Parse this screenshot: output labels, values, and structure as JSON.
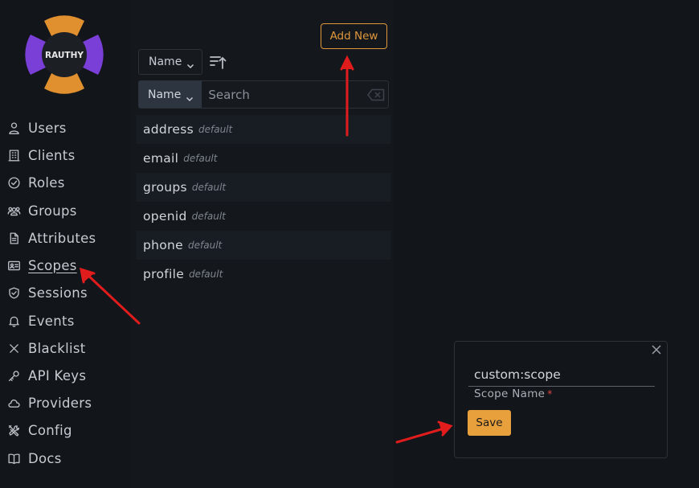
{
  "logo": {
    "text": "RAUTHY"
  },
  "nav": {
    "items": [
      {
        "label": "Users",
        "icon": "user-icon"
      },
      {
        "label": "Clients",
        "icon": "building-icon"
      },
      {
        "label": "Roles",
        "icon": "check-circle-icon"
      },
      {
        "label": "Groups",
        "icon": "users-group-icon"
      },
      {
        "label": "Attributes",
        "icon": "document-icon"
      },
      {
        "label": "Scopes",
        "icon": "id-card-icon",
        "active": true
      },
      {
        "label": "Sessions",
        "icon": "shield-check-icon"
      },
      {
        "label": "Events",
        "icon": "bell-icon"
      },
      {
        "label": "Blacklist",
        "icon": "x-icon"
      },
      {
        "label": "API Keys",
        "icon": "key-icon"
      },
      {
        "label": "Providers",
        "icon": "cloud-icon"
      },
      {
        "label": "Config",
        "icon": "tools-icon"
      },
      {
        "label": "Docs",
        "icon": "book-icon"
      }
    ]
  },
  "toolbar": {
    "add_new_label": "Add New",
    "sort_by_value": "Name",
    "search_field_value": "Name",
    "search_placeholder": "Search"
  },
  "scopes": [
    {
      "name": "address",
      "badge": "default"
    },
    {
      "name": "email",
      "badge": "default"
    },
    {
      "name": "groups",
      "badge": "default"
    },
    {
      "name": "openid",
      "badge": "default"
    },
    {
      "name": "phone",
      "badge": "default"
    },
    {
      "name": "profile",
      "badge": "default"
    }
  ],
  "modal": {
    "input_value": "custom:scope",
    "field_label": "Scope Name",
    "required_mark": "*",
    "save_label": "Save"
  },
  "colors": {
    "accent_orange": "#e0963a",
    "logo_purple": "#7a3fd6",
    "logo_orange": "#e0902e",
    "annotation_red": "#e01c1c"
  }
}
